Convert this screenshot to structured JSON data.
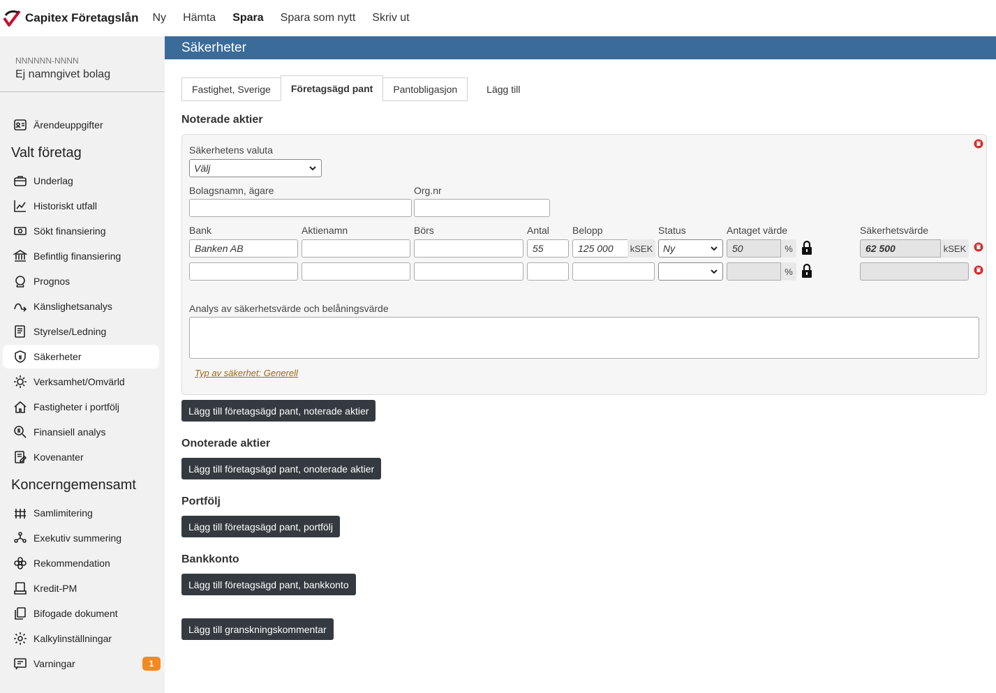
{
  "app": {
    "title": "Capitex Företagslån",
    "menu": [
      "Ny",
      "Hämta",
      "Spara",
      "Spara som nytt",
      "Skriv ut"
    ]
  },
  "company": {
    "orgnr": "NNNNNN-NNNN",
    "name": "Ej namngivet bolag"
  },
  "sidebar": {
    "top_item": {
      "label": "Ärendeuppgifter",
      "icon": "id-card-icon"
    },
    "section1": "Valt företag",
    "items1": [
      {
        "label": "Underlag",
        "icon": "briefcase-icon"
      },
      {
        "label": "Historiskt utfall",
        "icon": "chart-icon"
      },
      {
        "label": "Sökt finansiering",
        "icon": "money-icon"
      },
      {
        "label": "Befintlig finansiering",
        "icon": "bank-icon"
      },
      {
        "label": "Prognos",
        "icon": "crystal-ball-icon"
      },
      {
        "label": "Känslighetsanalys",
        "icon": "curve-arrow-icon"
      },
      {
        "label": "Styrelse/Ledning",
        "icon": "document-icon"
      },
      {
        "label": "Säkerheter",
        "icon": "shield-dollar-icon"
      },
      {
        "label": "Verksamhet/Omvärld",
        "icon": "lightbulb-icon"
      },
      {
        "label": "Fastigheter i portfölj",
        "icon": "house-icon"
      },
      {
        "label": "Finansiell analys",
        "icon": "search-dollar-icon"
      },
      {
        "label": "Kovenanter",
        "icon": "contract-icon"
      }
    ],
    "section2": "Koncerngemensamt",
    "items2": [
      {
        "label": "Samlimitering",
        "icon": "fence-icon"
      },
      {
        "label": "Exekutiv summering",
        "icon": "people-icon"
      },
      {
        "label": "Rekommendation",
        "icon": "flower-icon"
      },
      {
        "label": "Kredit-PM",
        "icon": "printer-icon"
      },
      {
        "label": "Bifogade dokument",
        "icon": "files-icon"
      },
      {
        "label": "Kalkylinställningar",
        "icon": "settings-icon"
      },
      {
        "label": "Varningar",
        "icon": "warning-icon",
        "badge": "1"
      }
    ]
  },
  "page": {
    "title": "Säkerheter",
    "tabs": [
      "Fastighet, Sverige",
      "Företagsägd pant",
      "Pantobligasjon"
    ],
    "add_tab": "Lägg till"
  },
  "noterade": {
    "title": "Noterade aktier",
    "currency_label": "Säkerhetens valuta",
    "currency_value": "Välj",
    "owner_label": "Bolagsnamn, ägare",
    "orgnr_label": "Org.nr",
    "col_bank": "Bank",
    "col_aktienamn": "Aktienamn",
    "col_bors": "Börs",
    "col_antal": "Antal",
    "col_belopp": "Belopp",
    "col_status": "Status",
    "col_antaget": "Antaget värde",
    "col_sakerhet": "Säkerhetsvärde",
    "row1": {
      "bank": "Banken AB",
      "antal": "55",
      "belopp": "125 000",
      "belopp_unit": "kSEK",
      "status": "Ny",
      "antaget": "50",
      "antaget_unit": "%",
      "sakerhet": "62 500",
      "sakerhet_unit": "kSEK"
    },
    "row2": {
      "antaget_unit": "%"
    },
    "analys_label": "Analys av säkerhetsvärde och belåningsvärde",
    "type_link": "Typ av säkerhet: Generell",
    "add_button": "Lägg till företagsägd pant, noterade aktier"
  },
  "onoterade": {
    "title": "Onoterade aktier",
    "add_button": "Lägg till företagsägd pant, onoterade aktier"
  },
  "portfolj": {
    "title": "Portfölj",
    "add_button": "Lägg till företagsägd pant, portfölj"
  },
  "bankkonto": {
    "title": "Bankkonto",
    "add_button": "Lägg till företagsägd pant, bankkonto"
  },
  "review_button": "Lägg till granskningskommentar",
  "colors": {
    "header": "#3b6b99",
    "button": "#343a40",
    "badge": "#f08a24",
    "trash": "#d32f2f"
  }
}
